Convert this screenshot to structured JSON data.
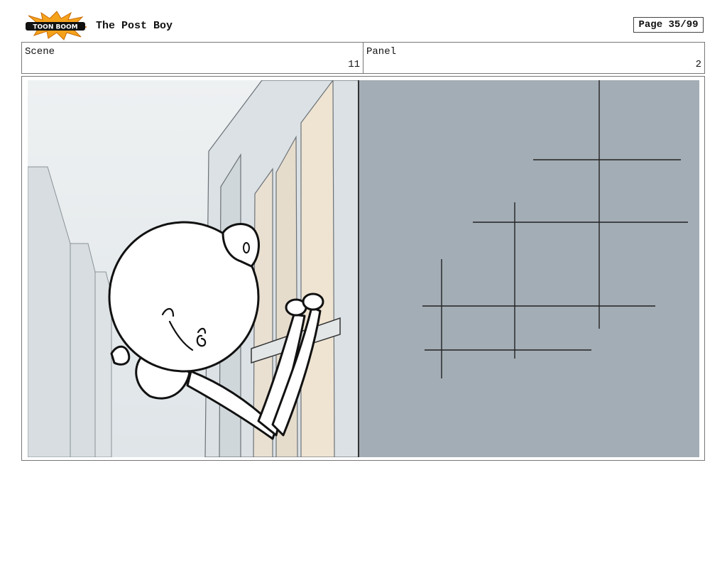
{
  "header": {
    "logo_text": "TOON BOOM",
    "title": "The Post Boy",
    "page_label": "Page 35/99"
  },
  "info": {
    "scene_label": "Scene",
    "scene_value": "11",
    "panel_label": "Panel",
    "panel_value": "2"
  },
  "panel_art": {
    "description_icon": "storyboard-drawing",
    "colors": {
      "sky": "#e8ecee",
      "buildings": "#d6dde0",
      "wall": "#a3adb5",
      "window": "#efe4d2",
      "line": "#111111"
    }
  }
}
